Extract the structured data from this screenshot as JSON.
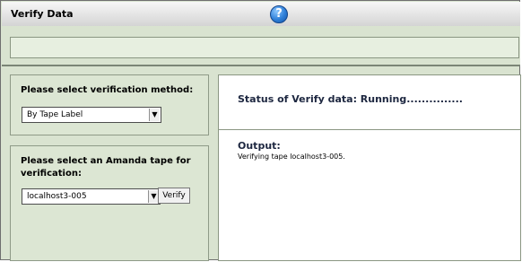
{
  "window": {
    "title": "Verify Data",
    "help_icon": "?"
  },
  "left_panel": {
    "method_prompt": "Please select verification method:",
    "method_selected": "By Tape Label",
    "tape_prompt_line1": "Please select an Amanda tape for",
    "tape_prompt_line2": "verification:",
    "tape_selected": "localhost3-005",
    "verify_button": "Verify"
  },
  "right_panel": {
    "status": "Status of Verify data: Running...............",
    "output_label": "Output:",
    "output_text": "Verifying tape localhost3-005."
  },
  "icons": {
    "dropdown": "chevron-down-icon",
    "help": "help-icon"
  }
}
